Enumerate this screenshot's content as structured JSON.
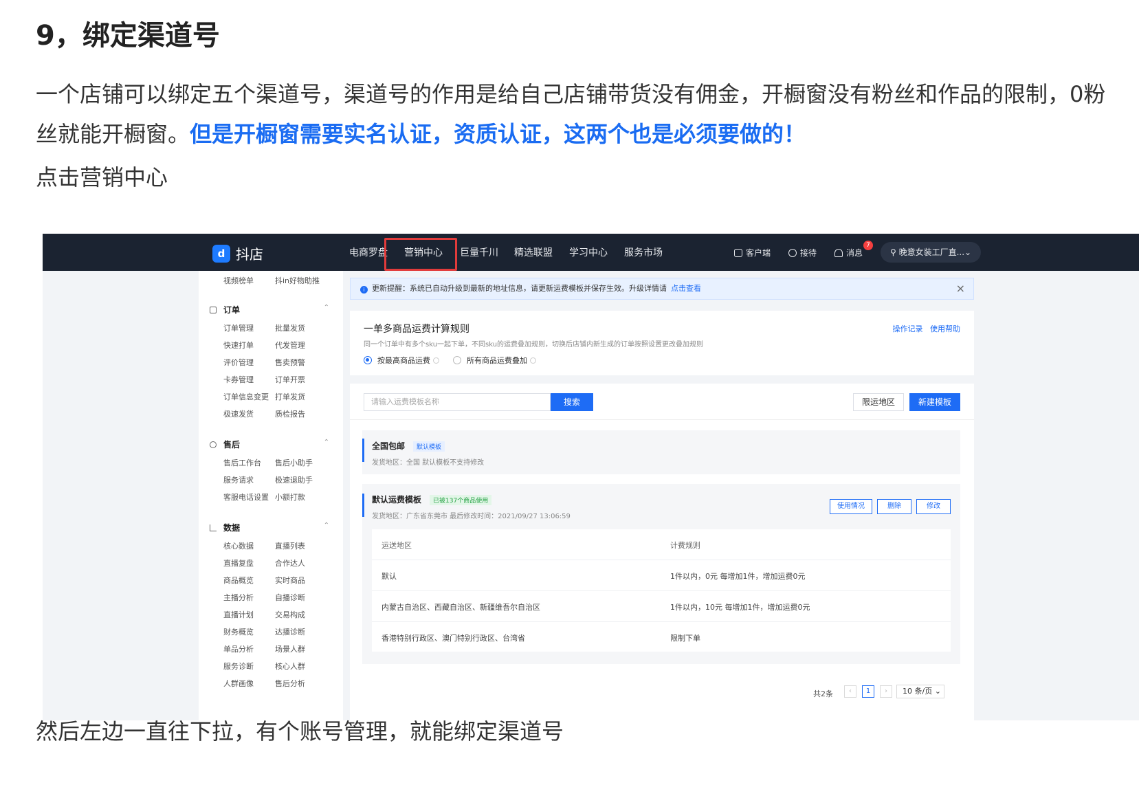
{
  "article": {
    "heading": "9，绑定渠道号",
    "para1_normal": "一个店铺可以绑定五个渠道号，渠道号的作用是给自己店铺带货没有佣金，开橱窗没有粉丝和作品的限制，0粉丝就能开橱窗。",
    "para1_highlight": "但是开橱窗需要实名认证，资质认证，这两个也是必须要做的！",
    "para2": "点击营销中心",
    "para3": "然后左边一直往下拉，有个账号管理，就能绑定渠道号"
  },
  "app": {
    "logo_mark": "d",
    "logo_text": "抖店",
    "nav": [
      "电商罗盘",
      "营销中心",
      "巨量千川",
      "精选联盟",
      "学习中心",
      "服务市场"
    ],
    "tools": [
      "客户端",
      "接待",
      "消息"
    ],
    "message_count": "7",
    "user": "晚意女装工厂直...⌄"
  },
  "sidebar": {
    "top_items": [
      "视频榜单",
      "抖in好物助推"
    ],
    "sections": [
      {
        "title": "订单",
        "items": [
          "订单管理",
          "批量发货",
          "快速打单",
          "代发管理",
          "评价管理",
          "售卖预警",
          "卡券管理",
          "订单开票",
          "订单信息变更",
          "打单发货",
          "极速发货",
          "质检报告"
        ]
      },
      {
        "title": "售后",
        "items": [
          "售后工作台",
          "售后小助手",
          "服务请求",
          "极速退助手",
          "客服电话设置",
          "小额打款"
        ]
      },
      {
        "title": "数据",
        "items": [
          "核心数据",
          "直播列表",
          "直播复盘",
          "合作达人",
          "商品概览",
          "实时商品",
          "主播分析",
          "自播诊断",
          "直播计划",
          "交易构成",
          "财务概览",
          "达播诊断",
          "单品分析",
          "场景人群",
          "服务诊断",
          "核心人群",
          "人群画像",
          "售后分析"
        ]
      }
    ]
  },
  "notice": {
    "icon": "i",
    "text": "更新提醒：系统已自动升级到最新的地址信息，请更新运费模板并保存生效。升级详情请",
    "link": "点击查看",
    "close": "×"
  },
  "rule_card": {
    "title": "一单多商品运费计算规则",
    "desc": "同一个订单中有多个sku一起下单，不同sku的运费叠加规则，切换后店铺内新生成的订单按照设置更改叠加规则",
    "links": [
      "操作记录",
      "使用帮助"
    ],
    "options": [
      "按最高商品运费",
      "所有商品运费叠加"
    ],
    "selected": 0
  },
  "toolbar": {
    "search_placeholder": "请输入运费模板名称",
    "search_btn": "搜索",
    "area_btn": "限运地区",
    "new_btn": "新建模板"
  },
  "templates": [
    {
      "name": "全国包邮",
      "tag": "默认模板",
      "desc": "发货地区：全国    默认模板不支持修改"
    },
    {
      "name": "默认运费模板",
      "tag": "已被137个商品使用",
      "desc": "发货地区：广东省东莞市    最后修改时间：2021/09/27 13:06:59",
      "buttons": [
        "使用情况",
        "删除",
        "修改"
      ]
    }
  ],
  "table": {
    "headers": [
      "运送地区",
      "计费规则"
    ],
    "rows": [
      [
        "默认",
        "1件以内，0元    每增加1件，增加运费0元"
      ],
      [
        "内蒙古自治区、西藏自治区、新疆维吾尔自治区",
        "1件以内，10元    每增加1件，增加运费0元"
      ],
      [
        "香港特别行政区、澳门特别行政区、台湾省",
        "限制下单"
      ]
    ]
  },
  "pager": {
    "total": "共2条",
    "prev": "‹",
    "page": "1",
    "next": "›",
    "size": "10 条/页 ⌄"
  },
  "colors": {
    "accent": "#1e6cf5",
    "highlight_text": "#1a6cf2",
    "topbar": "#1b2331",
    "red_box": "#e23b3b"
  }
}
